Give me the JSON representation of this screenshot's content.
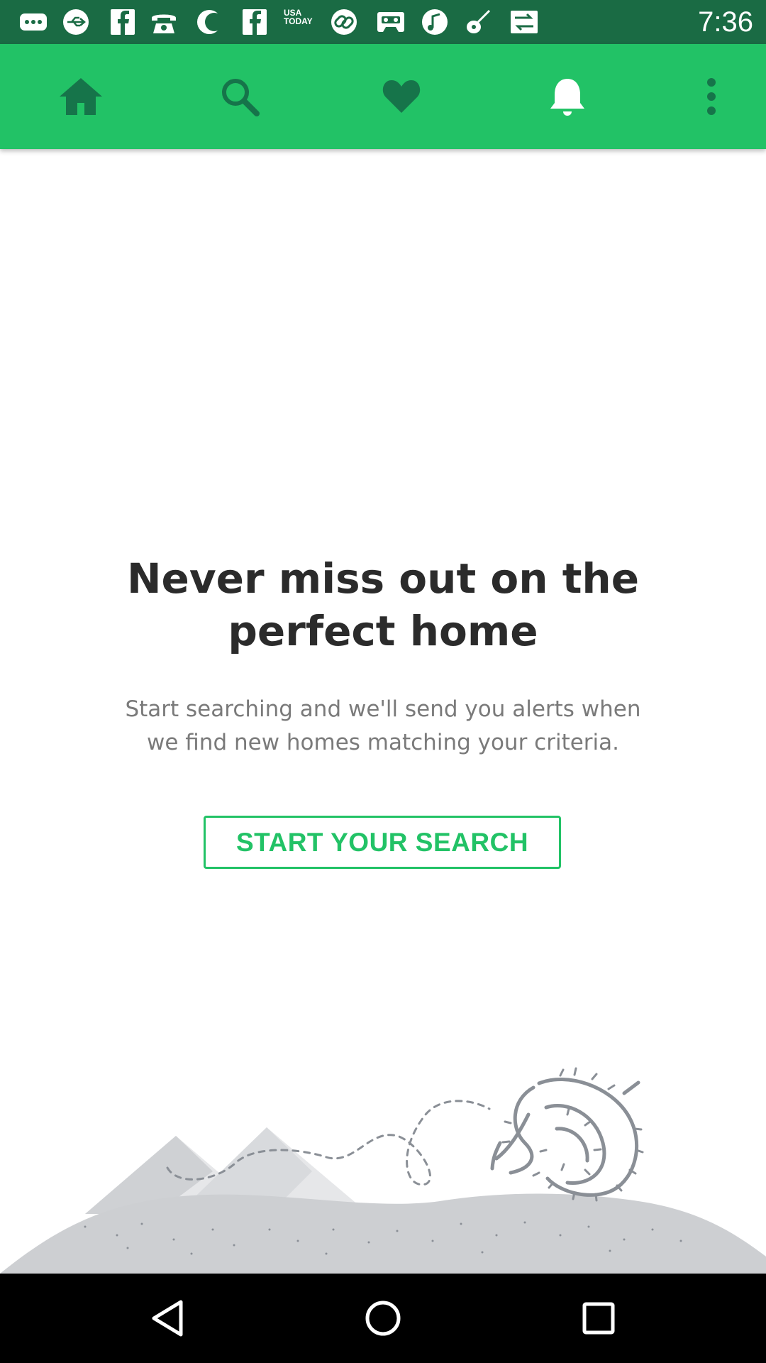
{
  "status_bar": {
    "time": "7:36",
    "usa_today_text": "USA TODAY",
    "icons": [
      "more-dots-icon",
      "usb-icon",
      "facebook-icon",
      "telephone-icon",
      "moon-icon",
      "facebook-icon",
      "usa-today-icon",
      "link-icon",
      "cassette-icon",
      "music-note-icon",
      "guitar-icon",
      "sync-icon"
    ]
  },
  "app_bar": {
    "tabs": [
      {
        "name": "home",
        "icon": "home-icon"
      },
      {
        "name": "search",
        "icon": "search-icon"
      },
      {
        "name": "favorites",
        "icon": "heart-icon"
      },
      {
        "name": "alerts",
        "icon": "bell-icon"
      },
      {
        "name": "more",
        "icon": "more-vertical-icon"
      }
    ],
    "active_tab": "alerts",
    "colors": {
      "bar": "#22c266",
      "active_icon": "#ffffff",
      "inactive_icon": "#16744a"
    }
  },
  "empty_state": {
    "headline_line1": "Never miss out on the",
    "headline_line2": "perfect home",
    "subtext_line1": "Start searching and we'll send you alerts when",
    "subtext_line2": "we find new homes matching your criteria.",
    "button_label": "START YOUR SEARCH",
    "illustration": "mountains-tumbleweed-illustration"
  },
  "nav_bar": {
    "buttons": [
      "back-icon",
      "home-circle-icon",
      "recents-icon"
    ]
  }
}
